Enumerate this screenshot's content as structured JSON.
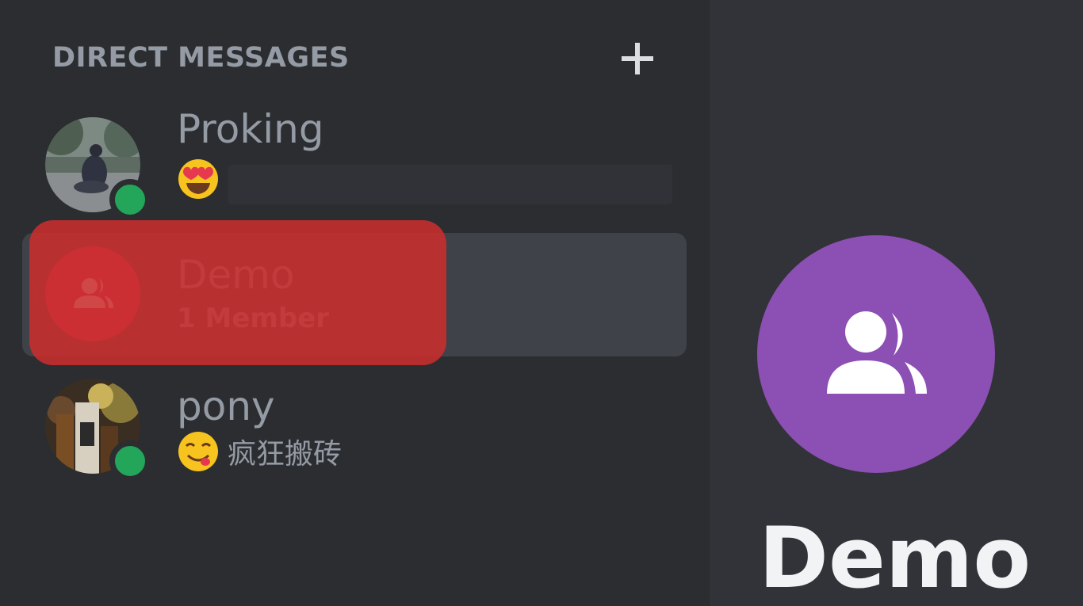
{
  "sidebar": {
    "header": {
      "title": "DIRECT MESSAGES",
      "add_icon": "plus-icon"
    },
    "items": [
      {
        "name": "Proking",
        "status": "online",
        "status_emoji": "heart-eyes-emoji",
        "status_text": ""
      },
      {
        "name": "Demo",
        "subtitle": "1 Member",
        "selected": true,
        "icon": "group-icon"
      },
      {
        "name": "pony",
        "status": "online",
        "status_emoji": "yum-emoji",
        "status_text": "疯狂搬砖"
      }
    ]
  },
  "main": {
    "group_name": "Demo",
    "icon": "group-icon",
    "avatar_color": "#8c4fb3"
  },
  "colors": {
    "sidebar_bg": "#2b2d31",
    "main_bg": "#313338",
    "selected_bg": "#404249",
    "online": "#23a55a",
    "highlight": "#c92e2e",
    "muted_text": "#949ba4",
    "demo_avatar": "#d93c5b"
  }
}
